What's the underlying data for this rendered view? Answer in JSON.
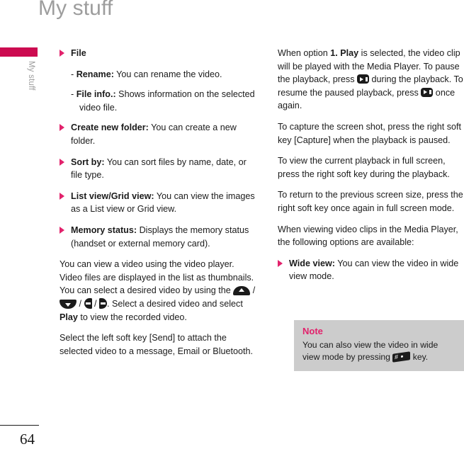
{
  "header": {
    "title": "My stuff"
  },
  "sidebar": {
    "tab_color": "#cc0b50",
    "label": "My stuff"
  },
  "colors": {
    "accent_pink": "#e2226c",
    "tab_crimson": "#cc0b50",
    "title_gray": "#9d9d9d",
    "note_background": "#cccccc",
    "text": "#1b1b1b"
  },
  "left_column": {
    "bullets": [
      {
        "label": "File",
        "text": "",
        "subitems": [
          {
            "dash": "-",
            "label": "Rename:",
            "text": " You can rename the video."
          },
          {
            "dash": "-",
            "label": "File info.:",
            "text": " Shows information on the selected video file."
          }
        ]
      },
      {
        "label": "Create new folder:",
        "text": " You can create a new folder."
      },
      {
        "label": "Sort by:",
        "text": " You can sort files by name, date, or file type."
      },
      {
        "label": "List view/Grid view:",
        "text": " You can view the images as a List view or Grid view."
      },
      {
        "label": "Memory status:",
        "text": " Displays the memory status (handset or external memory card)."
      }
    ],
    "paragraph_player": {
      "part1": "You can view a video using the video player. Video files are displayed in the list as thumbnails. You can select a desired video by using the ",
      "sep1": " / ",
      "sep2": " / ",
      "sep3": " / ",
      "part2": ". Select a desired video and select ",
      "bold_play": "Play",
      "part3": " to view the recorded video.",
      "icons": [
        "nav-up-key-icon",
        "nav-down-key-icon",
        "nav-left-key-icon",
        "nav-right-key-icon"
      ]
    },
    "paragraph_send": "Select the left soft key [Send] to attach the selected video to a message, Email or Bluetooth."
  },
  "right_column": {
    "paragraph_play": {
      "part1": "When option ",
      "bold1": "1. Play",
      "part2": " is selected, the video clip will be played with the Media Player. To pause the playback, press ",
      "part3": " during the playback. To resume the paused playback, press ",
      "part4": " once again.",
      "icon": "play-pause-key-icon"
    },
    "paragraph_capture": "To capture the screen shot, press the right soft key [Capture] when the playback is paused.",
    "paragraph_fullscreen": "To view the current playback in full screen, press the right soft key during the playback.",
    "paragraph_return": "To return to the previous screen size, press the right soft key once again in full screen mode.",
    "paragraph_options": "When viewing video clips in the Media Player, the following options are available:",
    "bullet_wide": {
      "label": "Wide view:",
      "text": " You can view the video in wide view mode."
    },
    "note": {
      "title": "Note",
      "part1": "You can also view the video in wide view mode by pressing ",
      "part2": " key.",
      "icon": "hash-key-icon"
    }
  },
  "footer": {
    "page_number": "64"
  }
}
